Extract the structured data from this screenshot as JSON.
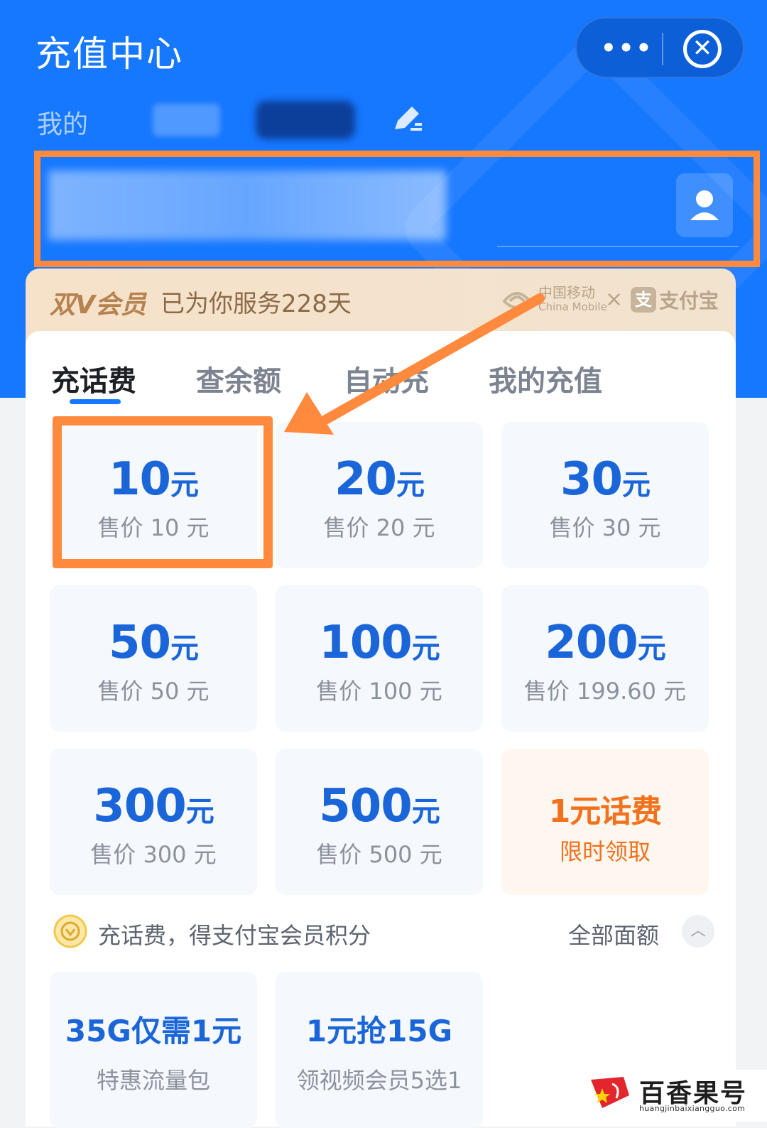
{
  "header": {
    "title": "充值中心",
    "more_label": "•••",
    "close_label": "✕",
    "mine_label": "我的"
  },
  "member": {
    "brand": "双V会员",
    "days_text": "已为你服务228天",
    "partner1_cn": "中国移动",
    "partner1_en": "China Mobile",
    "times": "×",
    "partner2_icon": "支",
    "partner2": "支付宝"
  },
  "tabs": [
    {
      "label": "充话费"
    },
    {
      "label": "查余额"
    },
    {
      "label": "自动充"
    },
    {
      "label": "我的充值"
    }
  ],
  "tiles": [
    {
      "amount": "10",
      "unit": "元",
      "price": "售价 10 元"
    },
    {
      "amount": "20",
      "unit": "元",
      "price": "售价 20 元"
    },
    {
      "amount": "30",
      "unit": "元",
      "price": "售价 30 元"
    },
    {
      "amount": "50",
      "unit": "元",
      "price": "售价 50 元"
    },
    {
      "amount": "100",
      "unit": "元",
      "price": "售价 100 元"
    },
    {
      "amount": "200",
      "unit": "元",
      "price": "售价 199.60 元"
    },
    {
      "amount": "300",
      "unit": "元",
      "price": "售价 300 元"
    },
    {
      "amount": "500",
      "unit": "元",
      "price": "售价 500 元"
    },
    {
      "amount": "1元话费",
      "unit": "",
      "price": "限时领取"
    }
  ],
  "points": {
    "text": "充话费，得支付宝会员积分",
    "all_label": "全部面额",
    "collapse_label": "︿"
  },
  "packages": [
    {
      "title": "35G仅需1元",
      "sub": "特惠流量包"
    },
    {
      "title": "1元抢15G",
      "sub": "领视频会员5选1"
    }
  ],
  "watermark": {
    "name": "百香果号",
    "url": "huangjinbaixiangguo.com"
  },
  "colors": {
    "primary": "#1677ff",
    "annotation": "#ff8a3d",
    "amount": "#1a66d9",
    "promo": "#f2711c"
  }
}
